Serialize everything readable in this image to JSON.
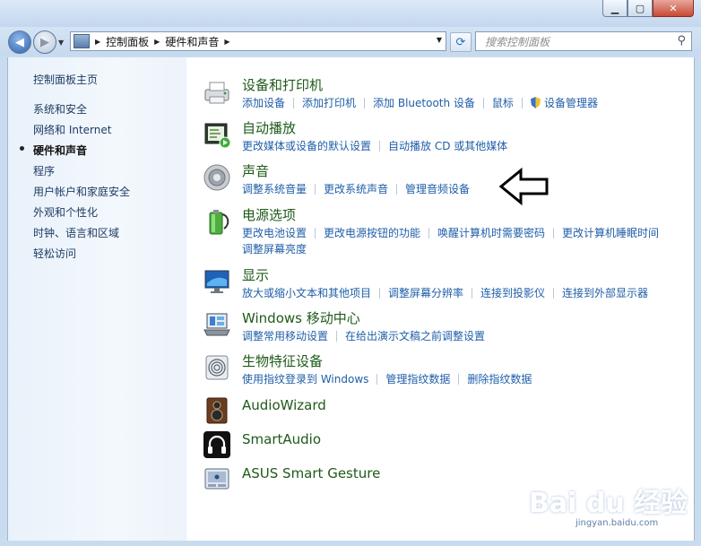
{
  "window": {
    "min": "▁",
    "max": "▢",
    "close": "✕"
  },
  "address": {
    "crumbs": [
      "控制面板",
      "硬件和声音"
    ],
    "search_placeholder": "搜索控制面板"
  },
  "sidebar": {
    "items": [
      {
        "label": "控制面板主页",
        "current": false
      },
      {
        "label": "系统和安全",
        "current": false
      },
      {
        "label": "网络和 Internet",
        "current": false
      },
      {
        "label": "硬件和声音",
        "current": true
      },
      {
        "label": "程序",
        "current": false
      },
      {
        "label": "用户帐户和家庭安全",
        "current": false
      },
      {
        "label": "外观和个性化",
        "current": false
      },
      {
        "label": "时钟、语言和区域",
        "current": false
      },
      {
        "label": "轻松访问",
        "current": false
      }
    ]
  },
  "categories": [
    {
      "title": "设备和打印机",
      "icon": "printer-icon",
      "links": [
        "添加设备",
        "添加打印机",
        "添加 Bluetooth 设备",
        "鼠标",
        "设备管理器"
      ],
      "links2": []
    },
    {
      "title": "自动播放",
      "icon": "autoplay-icon",
      "links": [
        "更改媒体或设备的默认设置",
        "自动播放 CD 或其他媒体"
      ],
      "links2": []
    },
    {
      "title": "声音",
      "icon": "speaker-icon",
      "links": [
        "调整系统音量",
        "更改系统声音",
        "管理音频设备"
      ],
      "links2": []
    },
    {
      "title": "电源选项",
      "icon": "battery-icon",
      "links": [
        "更改电池设置",
        "更改电源按钮的功能",
        "唤醒计算机时需要密码",
        "更改计算机睡眠时间"
      ],
      "links2": [
        "调整屏幕亮度"
      ]
    },
    {
      "title": "显示",
      "icon": "monitor-icon",
      "links": [
        "放大或缩小文本和其他项目",
        "调整屏幕分辨率",
        "连接到投影仪",
        "连接到外部显示器"
      ],
      "links2": []
    },
    {
      "title": "Windows 移动中心",
      "icon": "mobility-center-icon",
      "links": [
        "调整常用移动设置",
        "在给出演示文稿之前调整设置"
      ],
      "links2": []
    },
    {
      "title": "生物特征设备",
      "icon": "fingerprint-icon",
      "links": [
        "使用指纹登录到 Windows",
        "管理指纹数据",
        "删除指纹数据"
      ],
      "links2": []
    },
    {
      "title": "AudioWizard",
      "icon": "audiowizard-icon",
      "links": [],
      "links2": []
    },
    {
      "title": "SmartAudio",
      "icon": "headphones-icon",
      "links": [],
      "links2": []
    },
    {
      "title": "ASUS Smart Gesture",
      "icon": "touchpad-icon",
      "links": [],
      "links2": []
    }
  ],
  "watermark": {
    "text": "Bai du 经验",
    "sub": "jingyan.baidu.com"
  }
}
